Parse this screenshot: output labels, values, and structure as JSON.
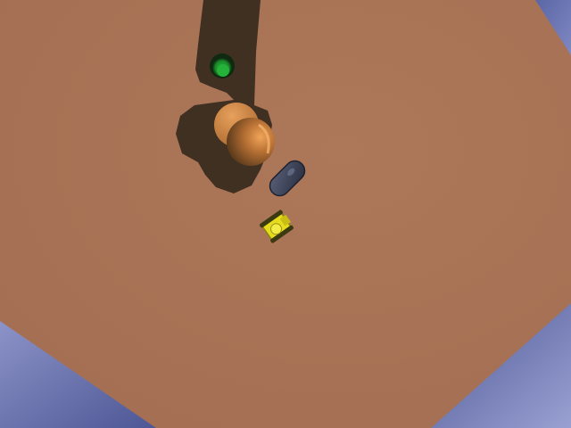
{
  "scene": {
    "view": "top-down",
    "surface": "sandy ground",
    "colors": {
      "ground": "#a97358",
      "ground_light": "#b07a5e",
      "dug_trail": "#3a2c20",
      "water_light": "#8c93c8",
      "water_dark": "#4d5795",
      "hole_rim": "#0f2a10",
      "hole_inner": "#1fa032",
      "boulder_light": "#d98b40",
      "boulder_dark": "#5e3c1c",
      "capsule": "#3d4357",
      "vehicle": "#e6dc1e"
    },
    "objects": [
      {
        "id": "green-hole",
        "kind": "hole",
        "icon": "green-hole-icon"
      },
      {
        "id": "orange-boulder",
        "kind": "boulder",
        "icon": "boulder-icon"
      },
      {
        "id": "grey-capsule",
        "kind": "capsule",
        "icon": "capsule-icon"
      },
      {
        "id": "yellow-vehicle",
        "kind": "player-vehicle",
        "icon": "digger-vehicle-icon"
      }
    ]
  }
}
